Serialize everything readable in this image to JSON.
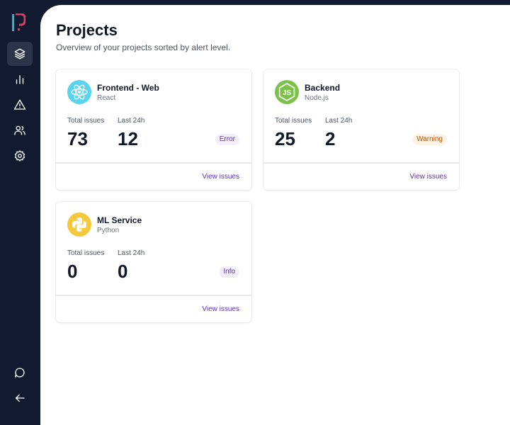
{
  "page": {
    "title": "Projects",
    "subtitle": "Overview of your projects sorted by alert level."
  },
  "sidebar": {
    "items": [
      {
        "icon": "layers-icon",
        "active": true
      },
      {
        "icon": "bar-chart-icon",
        "active": false
      },
      {
        "icon": "alert-triangle-icon",
        "active": false
      },
      {
        "icon": "users-icon",
        "active": false
      },
      {
        "icon": "settings-icon",
        "active": false
      }
    ],
    "bottom_items": [
      {
        "icon": "chat-bubble-icon"
      },
      {
        "icon": "arrow-left-icon"
      }
    ]
  },
  "projects": [
    {
      "name": "Frontend - Web",
      "platform": "React",
      "icon": "react-icon",
      "icon_bg": "#5ad3ef",
      "total_label": "Total issues",
      "total": "73",
      "recent_label": "Last 24h",
      "recent": "12",
      "level": "Error",
      "link": "View issues"
    },
    {
      "name": "Backend",
      "platform": "Node.js",
      "icon": "nodejs-icon",
      "icon_bg": "#7cc24a",
      "total_label": "Total issues",
      "total": "25",
      "recent_label": "Last 24h",
      "recent": "2",
      "level": "Warning",
      "link": "View issues"
    },
    {
      "name": "ML Service",
      "platform": "Python",
      "icon": "python-icon",
      "icon_bg": "#f6c83c",
      "total_label": "Total issues",
      "total": "0",
      "recent_label": "Last 24h",
      "recent": "0",
      "level": "Info",
      "link": "View issues"
    }
  ],
  "colors": {
    "sidebar_bg": "#111a2e",
    "accent": "#5b2fb0",
    "logo_primary": "#2ab3c9",
    "logo_secondary": "#e33b63",
    "warning": "#b45309"
  }
}
